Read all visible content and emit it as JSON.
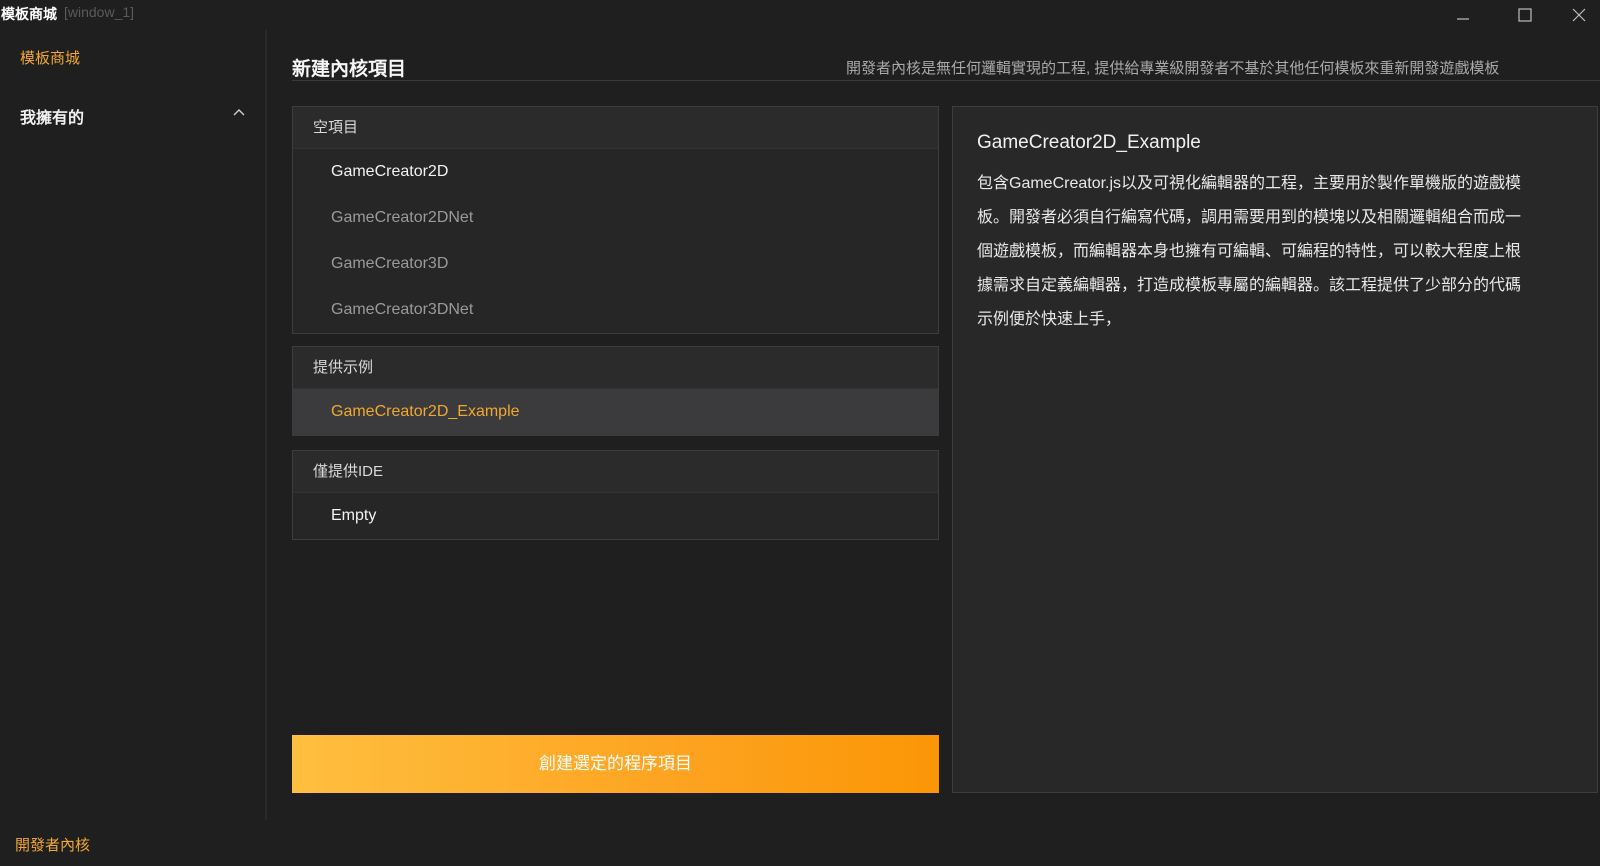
{
  "window": {
    "title": "模板商城",
    "subtitle": "[window_1]"
  },
  "sidebar": {
    "store_label": "模板商城",
    "owned_label": "我擁有的",
    "footer_label": "開發者內核"
  },
  "header": {
    "title": "新建內核項目",
    "description": "開發者內核是無任何邏輯實現的工程, 提供給專業級開發者不基於其他任何模板來重新開發遊戲模板"
  },
  "groups": [
    {
      "label": "空項目",
      "items": [
        "GameCreator2D",
        "GameCreator2DNet",
        "GameCreator3D",
        "GameCreator3DNet"
      ]
    },
    {
      "label": "提供示例",
      "items": [
        "GameCreator2D_Example"
      ]
    },
    {
      "label": "僅提供IDE",
      "items": [
        "Empty"
      ]
    }
  ],
  "selected_item": "GameCreator2D_Example",
  "detail": {
    "title": "GameCreator2D_Example",
    "body_lines": [
      "包含GameCreator.js以及可視化編輯器的工程，主要用於製作單機版的遊戲模",
      "板。開發者必須自行編寫代碼，調用需要用到的模塊以及相關邏輯組合而成一",
      "個遊戲模板，而編輯器本身也擁有可編輯、可編程的特性，可以較大程度上根",
      "據需求自定義編輯器，打造成模板專屬的編輯器。該工程提供了少部分的代碼",
      "示例便於快速上手，"
    ]
  },
  "create_button_label": "創建選定的程序項目",
  "colors": {
    "accent": "#f0a830",
    "background": "#1f1f1f",
    "panel": "#262626",
    "button_gradient_start": "#ffbf3f",
    "button_gradient_end": "#fb9605"
  }
}
